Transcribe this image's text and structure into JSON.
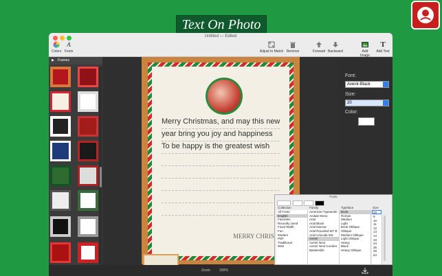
{
  "banner": {
    "title": "Text On Photo"
  },
  "window": {
    "title": "Untitled — Edited"
  },
  "toolbar": {
    "colors": "Colors",
    "fonts": "Fonts",
    "adjust": "Adjust to Match",
    "remove": "Remove",
    "forward": "Forward",
    "backward": "Backward",
    "add_image": "Add Image",
    "add_text": "Add Text"
  },
  "sidebar": {
    "header": "Frames"
  },
  "letter": {
    "lines": [
      "Merry Christmas, and may this new",
      "year bring you joy and happiness",
      "To be happy is the greatest wish"
    ],
    "stamp": "MERRY CHRISTMAS"
  },
  "panel": {
    "font_label": "Font:",
    "font_value": "Avenir-Black",
    "size_label": "Size:",
    "size_value": "20",
    "color_label": "Color:"
  },
  "fonts_panel": {
    "title": "Fonts",
    "headers": {
      "collection": "Collection",
      "family": "Family",
      "typeface": "Typeface",
      "size": "Size"
    },
    "collections": [
      "All Fonts",
      "English",
      "Favorites",
      "Recently Used",
      "Fixed Width",
      "Fun",
      "Modern",
      "PDF",
      "Traditional",
      "Web"
    ],
    "families": [
      "American Typewriter",
      "Andale Mono",
      "Arial",
      "Arial Black",
      "Arial Narrow",
      "Arial Rounded MT B",
      "Arial Unicode MS",
      "Avenir",
      "Avenir Next",
      "Avenir Next Conden",
      "Baskerville"
    ],
    "typefaces": [
      "Book",
      "Roman",
      "Medium",
      "Light",
      "Book Oblique",
      "Oblique",
      "Medium Oblique",
      "Light Oblique",
      "Heavy",
      "Black",
      "Heavy Oblique"
    ],
    "sizes": [
      "9",
      "10",
      "11",
      "12",
      "13",
      "14",
      "18",
      "24",
      "36",
      "48",
      "64"
    ],
    "size_value": "20"
  },
  "bottom": {
    "zoom_label": "Zoom",
    "zoom_value": "100%"
  },
  "colors": {
    "bg": "#1f9a43",
    "accent": "#2d7ef0",
    "stripe_red": "#d42a2a",
    "stripe_green": "#1e8a3a"
  }
}
